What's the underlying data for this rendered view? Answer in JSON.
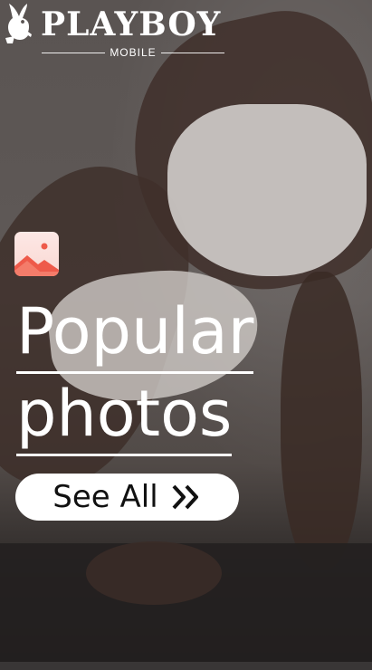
{
  "header": {
    "brand": "PLAYBOY",
    "subtitle": "MOBILE",
    "logo_icon": "bunny-logo-icon"
  },
  "hero": {
    "icon": "photo-gallery-icon",
    "title_line1": "Popular",
    "title_line2": "photos",
    "cta_label": "See All",
    "cta_icon": "double-chevron-right-icon"
  },
  "colors": {
    "cta_background": "#ffffff",
    "icon_background": "#fde8e5",
    "icon_accent": "#ee5a4a"
  }
}
